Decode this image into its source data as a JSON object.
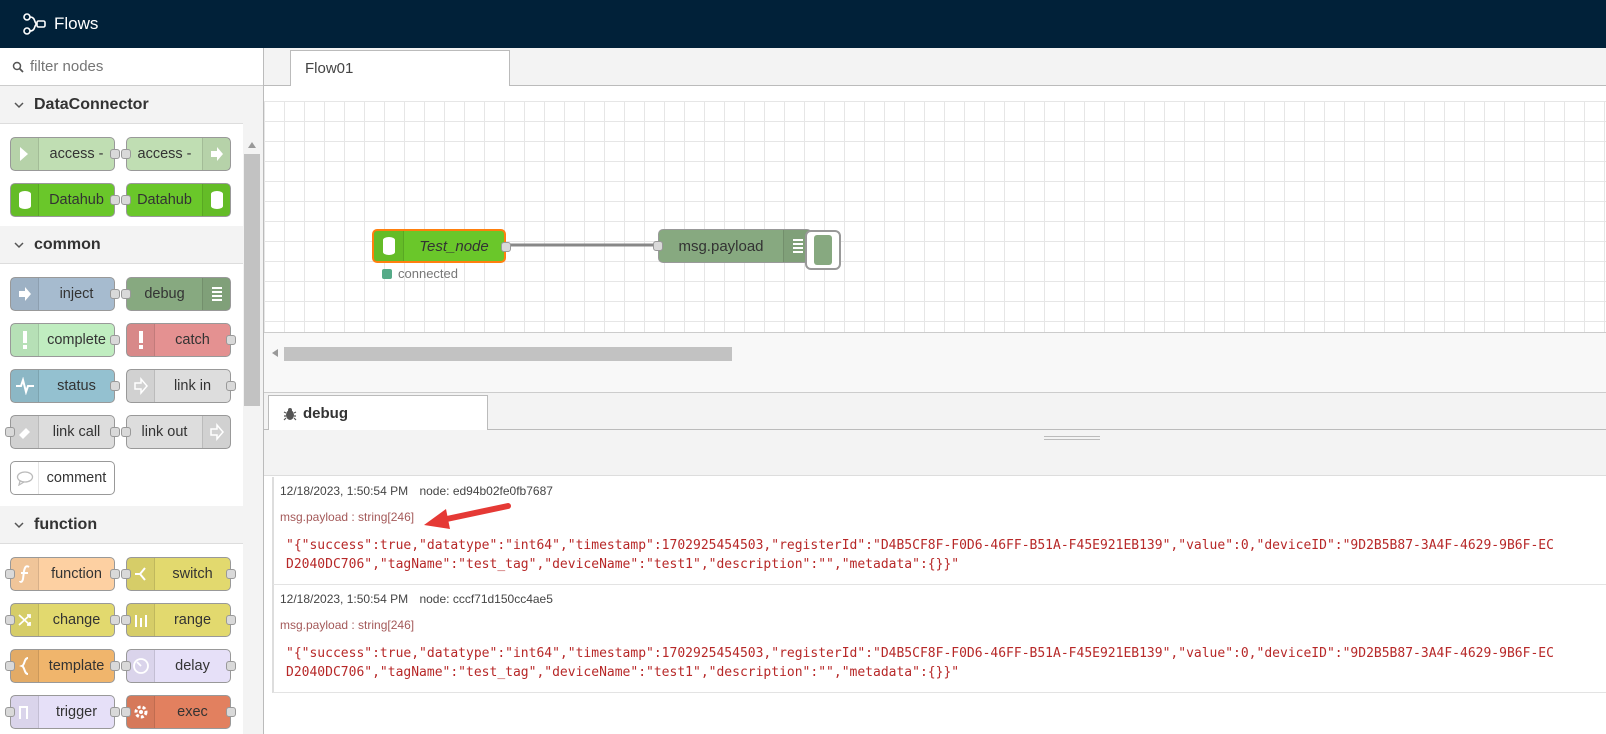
{
  "header": {
    "title": "Flows"
  },
  "palette": {
    "search_placeholder": "filter nodes",
    "categories": [
      {
        "label": "DataConnector"
      },
      {
        "label": "common"
      },
      {
        "label": "function"
      }
    ],
    "nodes": {
      "access_in": "access -",
      "access_out": "access -",
      "datahub_in": "Datahub",
      "datahub_out": "Datahub",
      "inject": "inject",
      "debug": "debug",
      "complete": "complete",
      "catch": "catch",
      "status": "status",
      "link_in": "link in",
      "link_call": "link call",
      "link_out": "link out",
      "comment": "comment",
      "function": "function",
      "switch": "switch",
      "change": "change",
      "range": "range",
      "template": "template",
      "delay": "delay",
      "trigger": "trigger",
      "exec": "exec"
    },
    "colors": {
      "access": "#c0deb3",
      "datahub": "#6ac72a",
      "inject": "#a6bbcf",
      "debug": "#87a980",
      "complete": "#c0edc0",
      "catch": "#e49191",
      "status": "#94c1d0",
      "link": "#dddddd",
      "comment": "#ffffff",
      "function": "#fdd0a2",
      "switch": "#e2d96e",
      "template": "#f0b56c",
      "delay": "#e6e0f8",
      "exec": "#e2805f",
      "trigger": "#e6e0f8"
    }
  },
  "workspace": {
    "tab": "Flow01",
    "nodes": {
      "test_node": {
        "label": "Test_node",
        "status": "connected",
        "color": "#6ac72a"
      },
      "debug_node": {
        "label": "msg.payload",
        "color": "#87a980"
      }
    }
  },
  "sidebar": {
    "tab": "debug",
    "messages": [
      {
        "timestamp": "12/18/2023, 1:50:54 PM",
        "node": "node: ed94b02fe0fb7687",
        "type": "msg.payload : string[246]",
        "value": "\"{\"success\":true,\"datatype\":\"int64\",\"timestamp\":1702925454503,\"registerId\":\"D4B5CF8F-F0D6-46FF-B51A-F45E921EB139\",\"value\":0,\"deviceID\":\"9D2B5B87-3A4F-4629-9B6F-ECD2040DC706\",\"tagName\":\"test_tag\",\"deviceName\":\"test1\",\"description\":\"\",\"metadata\":{}}\""
      },
      {
        "timestamp": "12/18/2023, 1:50:54 PM",
        "node": "node: cccf71d150cc4ae5",
        "type": "msg.payload : string[246]",
        "value": "\"{\"success\":true,\"datatype\":\"int64\",\"timestamp\":1702925454503,\"registerId\":\"D4B5CF8F-F0D6-46FF-B51A-F45E921EB139\",\"value\":0,\"deviceID\":\"9D2B5B87-3A4F-4629-9B6F-ECD2040DC706\",\"tagName\":\"test_tag\",\"deviceName\":\"test1\",\"description\":\"\",\"metadata\":{}}\""
      }
    ]
  },
  "annotation": {
    "arrow_color": "#e53935"
  }
}
